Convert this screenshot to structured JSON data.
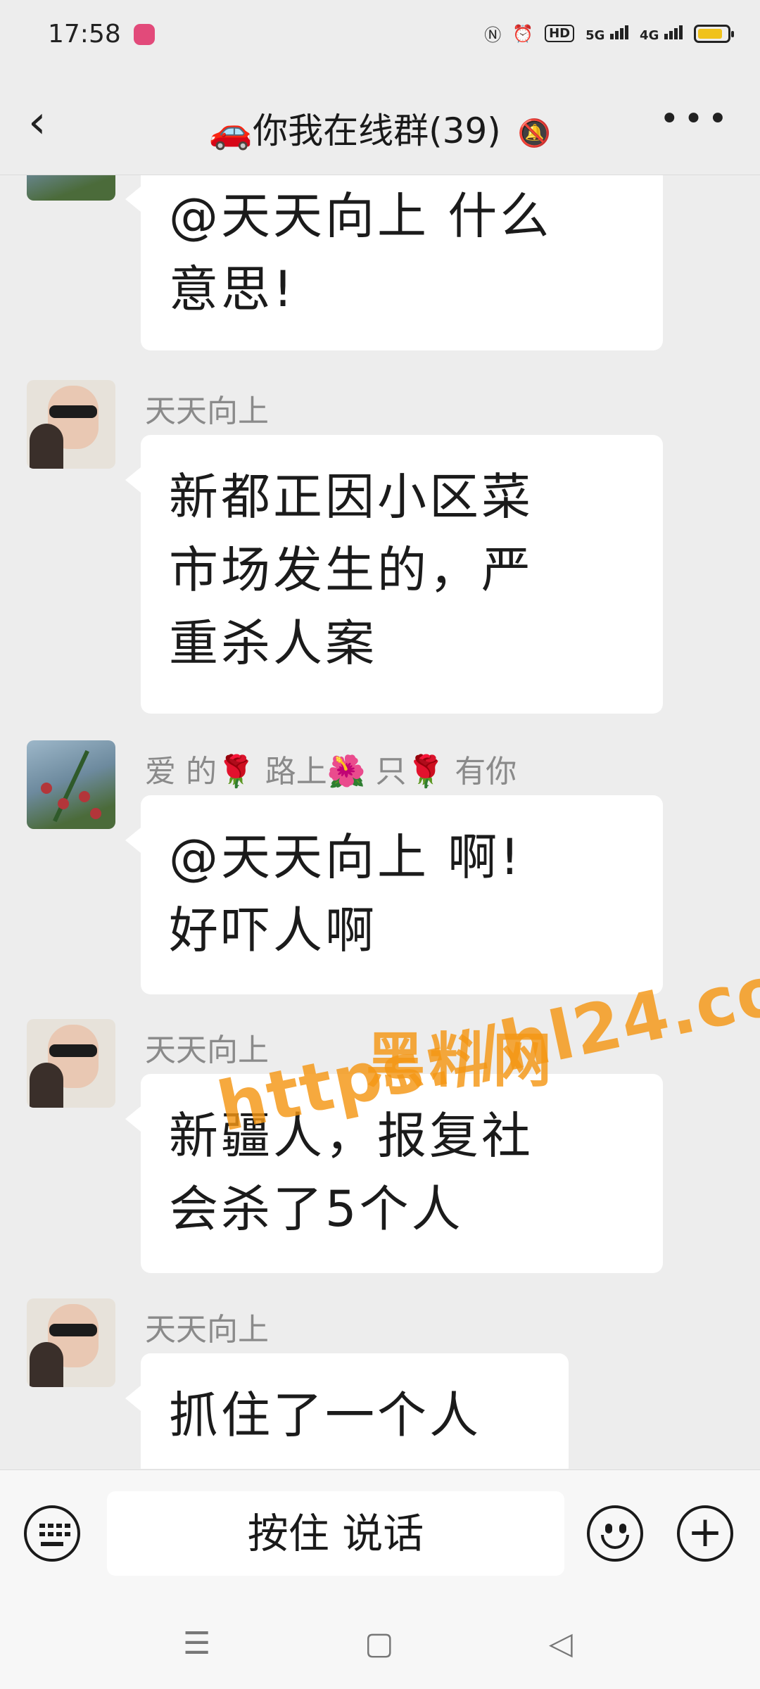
{
  "status_bar": {
    "time": "17:58",
    "icons": [
      "notification-app-icon",
      "nfc-icon",
      "alarm-icon",
      "hd-voice-icon",
      "5g-signal-icon",
      "4g-signal-icon",
      "battery-icon"
    ],
    "hd_label": "HD",
    "net1": "5G",
    "net2": "4G",
    "battery_level": 0.85,
    "battery_color": "#f0c21a"
  },
  "header": {
    "title": "🚗你我在线群(39)",
    "back_icon": "chevron-left-icon",
    "mute_icon": "bell-muted-icon",
    "more_icon": "more-dots-icon"
  },
  "messages": [
    {
      "text": "@天天向上  什么\n意思!"
    },
    {
      "sender": "天天向上",
      "text": "新都正因小区菜\n市场发生的，严\n重杀人案"
    },
    {
      "sender": "爱  的🌹 路上🌺 只🌹 有你",
      "text": "@天天向上  啊!\n好吓人啊"
    },
    {
      "sender": "天天向上",
      "text": "新疆人，报复社\n会杀了5个人"
    },
    {
      "sender": "天天向上",
      "text": "抓住了一个人"
    }
  ],
  "watermark": {
    "line1": "黑料网",
    "line2": "https://hl24.co"
  },
  "input_bar": {
    "keyboard_icon": "keyboard-icon",
    "voice_label": "按住 说话",
    "emoji_icon": "emoji-icon",
    "plus_icon": "plus-icon"
  },
  "system_nav": {
    "menu_icon": "menu-icon",
    "home_icon": "home-square-icon",
    "back_icon": "back-triangle-icon"
  },
  "colors": {
    "background": "#ededed",
    "bubble": "#ffffff",
    "watermark": "#f49614"
  }
}
